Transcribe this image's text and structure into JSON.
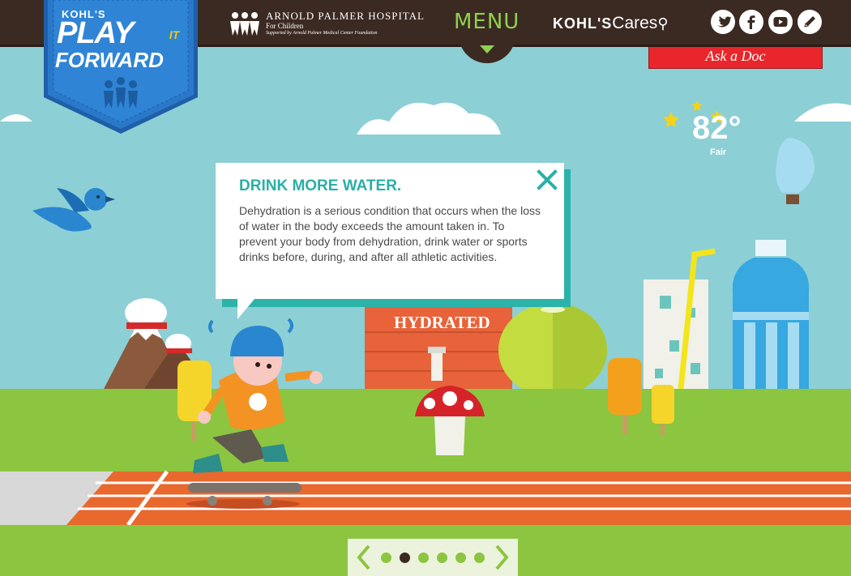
{
  "header": {
    "menu_label": "MENU",
    "hospital": {
      "name": "ARNOLD PALMER HOSPITAL",
      "sub": "For Children",
      "supported": "Supported by Arnold Palmer Medical Center Foundation"
    },
    "kohls_cares": {
      "part1": "KOHL'S",
      "part2": "Cares"
    },
    "social_icons": [
      "twitter-icon",
      "facebook-icon",
      "youtube-icon",
      "pencil-icon"
    ]
  },
  "logo": {
    "brand": "KOHL'S",
    "line1": "PLAY",
    "line2": "FORWARD",
    "badge": "IT"
  },
  "ask_doc": "Ask a Doc",
  "weather": {
    "temperature": "82°",
    "condition": "Fair"
  },
  "popup": {
    "title": "DRINK MORE WATER.",
    "body": "Dehydration is a serious condition that occurs when the loss of water in the body exceeds the amount taken in. To prevent your body from dehydration, drink water or sports drinks before, during, and after all athletic activities."
  },
  "scene": {
    "sign_text": "HYDRATED"
  },
  "pager": {
    "total_pages": 6,
    "active_page": 2
  },
  "colors": {
    "header_brown": "#3b2a22",
    "sky": "#8ccfd5",
    "grass": "#8cc540",
    "teal_accent": "#28b0a6",
    "ask_doc_red": "#e8262b",
    "menu_green": "#8fd14f"
  }
}
